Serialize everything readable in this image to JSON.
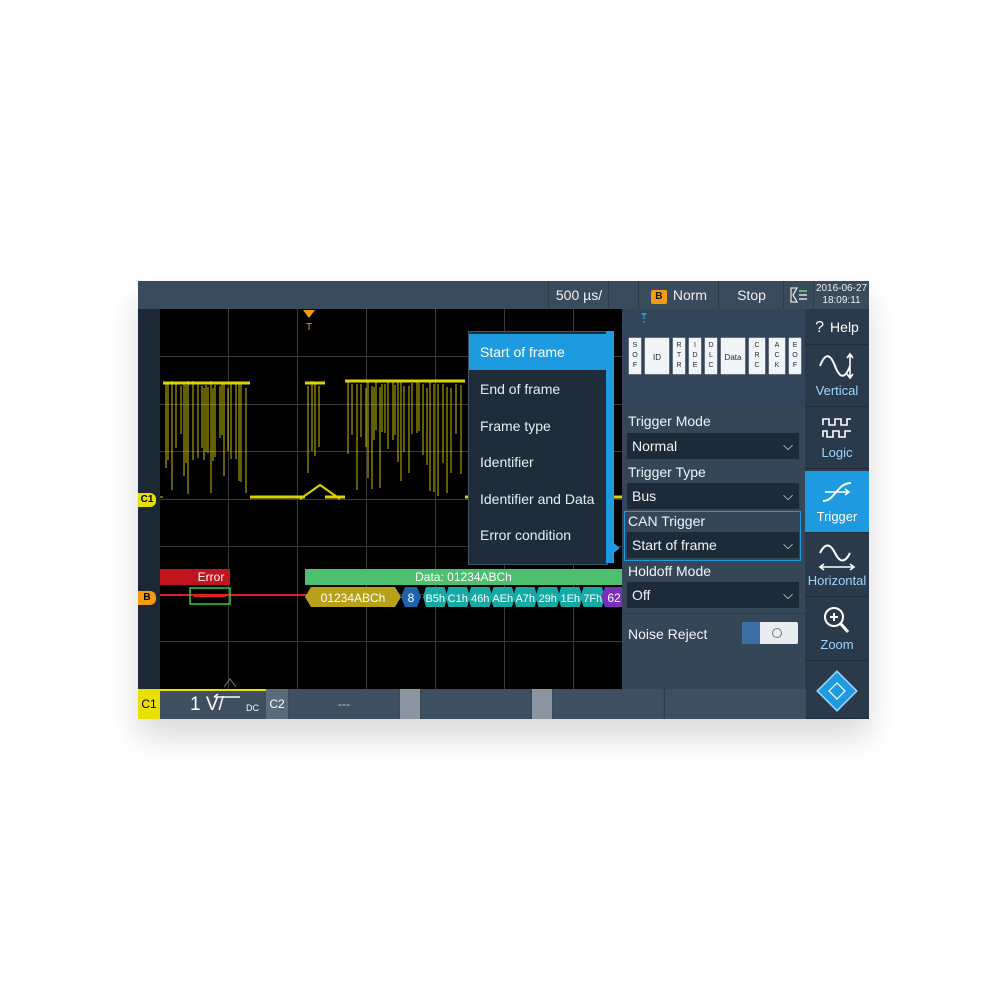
{
  "topbar": {
    "timebase": "500 µs/",
    "trigger_source": "B",
    "trigger_mode_display": "Norm",
    "run_state": "Stop",
    "date": "2016-06-27",
    "time": "18:09:11"
  },
  "waveform": {
    "trigger_marker": "T",
    "channel_tag": "C1",
    "bus_tag": "B",
    "error_label": "Error",
    "data_header": "Data: 01234ABCh",
    "id_value": "01234ABCh",
    "dlc_value": "8",
    "bytes": [
      "B5h",
      "C1h",
      "46h",
      "AEh",
      "A7h",
      "29h",
      "1Eh",
      "7Fh"
    ],
    "crc_value": "62"
  },
  "menu": {
    "items": [
      {
        "label": "Start of frame",
        "selected": true
      },
      {
        "label": "End of frame",
        "selected": false
      },
      {
        "label": "Frame type",
        "selected": false
      },
      {
        "label": "Identifier",
        "selected": false
      },
      {
        "label": "Identifier and Data",
        "selected": false
      },
      {
        "label": "Error condition",
        "selected": false
      }
    ]
  },
  "frame_diagram": {
    "fields": [
      "S O F",
      "ID",
      "R T R",
      "I D E",
      "D L C",
      "Data",
      "C R C",
      "A C K",
      "E O F"
    ]
  },
  "panel": {
    "trigger_mode_label": "Trigger Mode",
    "trigger_mode_value": "Normal",
    "trigger_type_label": "Trigger Type",
    "trigger_type_value": "Bus",
    "can_trigger_label": "CAN Trigger",
    "can_trigger_value": "Start of frame",
    "holdoff_label": "Holdoff Mode",
    "holdoff_value": "Off",
    "noise_reject_label": "Noise Reject"
  },
  "nav": {
    "help": "Help",
    "vertical": "Vertical",
    "logic": "Logic",
    "trigger": "Trigger",
    "horizontal": "Horizontal",
    "zoom": "Zoom"
  },
  "bottom": {
    "c1_tag": "C1",
    "c1_scale": "1 V/",
    "c1_coupling": "DC",
    "c2_tag": "C2",
    "c2_value": "---"
  },
  "colors": {
    "accent": "#1e9be0",
    "channel1": "#e8e000",
    "bus": "#f39c12",
    "error": "#c0141e",
    "data": "#4cc06e"
  }
}
